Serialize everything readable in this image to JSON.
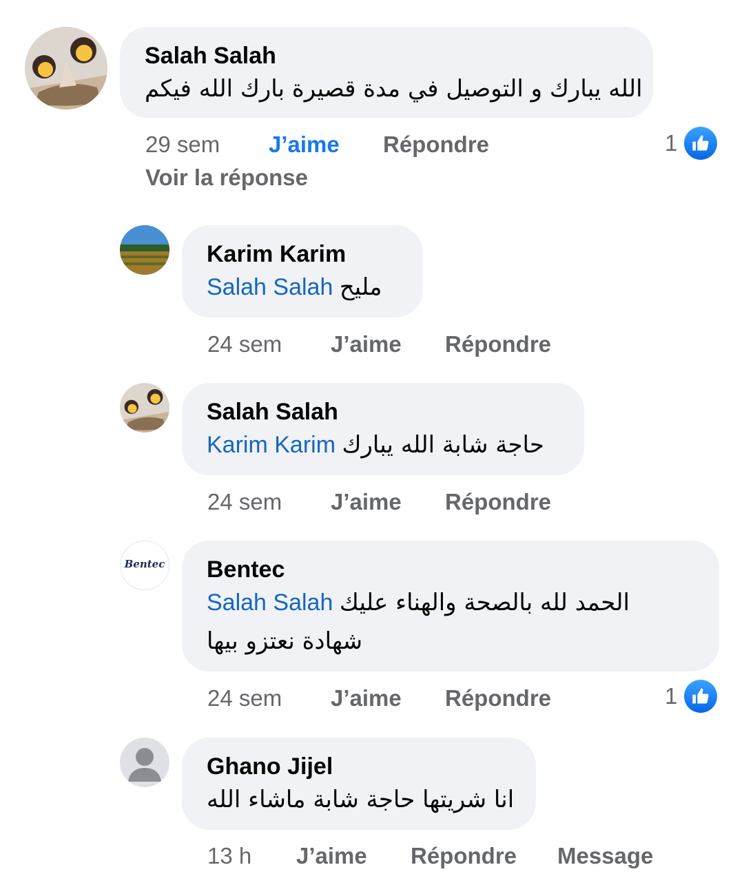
{
  "colors": {
    "bubble": "#f0f2f5",
    "mention": "#1565c0",
    "meta": "#65676b",
    "liked": "#1877f2"
  },
  "comments": [
    {
      "author": "Salah Salah",
      "mention": "",
      "text": "الله يبارك و التوصيل في مدة قصيرة بارك الله فيكم",
      "time": "29 sem",
      "like": "J’aime",
      "reply": "Répondre",
      "reactions": "1",
      "view_replies": "Voir la réponse",
      "avatar_icon": "photo-avatar"
    },
    {
      "author": "Karim Karim",
      "mention": "Salah Salah",
      "text": "مليح",
      "time": "24 sem",
      "like": "J’aime",
      "reply": "Répondre",
      "avatar_icon": "landscape-avatar"
    },
    {
      "author": "Salah Salah",
      "mention": "Karim Karim",
      "text": "حاجة شابة الله يبارك",
      "time": "24 sem",
      "like": "J’aime",
      "reply": "Répondre",
      "avatar_icon": "photo-avatar"
    },
    {
      "author": "Bentec",
      "mention": "Salah Salah",
      "text": "الحمد لله بالصحة والهناء عليك",
      "text_line2": "شهادة نعتزو بيها",
      "logo_text": "Bentec",
      "time": "24 sem",
      "like": "J’aime",
      "reply": "Répondre",
      "reactions": "1",
      "avatar_icon": "bentec-logo"
    },
    {
      "author": "Ghano Jijel",
      "mention": "",
      "text": "انا شريتها حاجة شابة ماشاء الله",
      "time": "13 h",
      "like": "J’aime",
      "reply": "Répondre",
      "message": "Message",
      "avatar_icon": "default-user-icon"
    }
  ]
}
